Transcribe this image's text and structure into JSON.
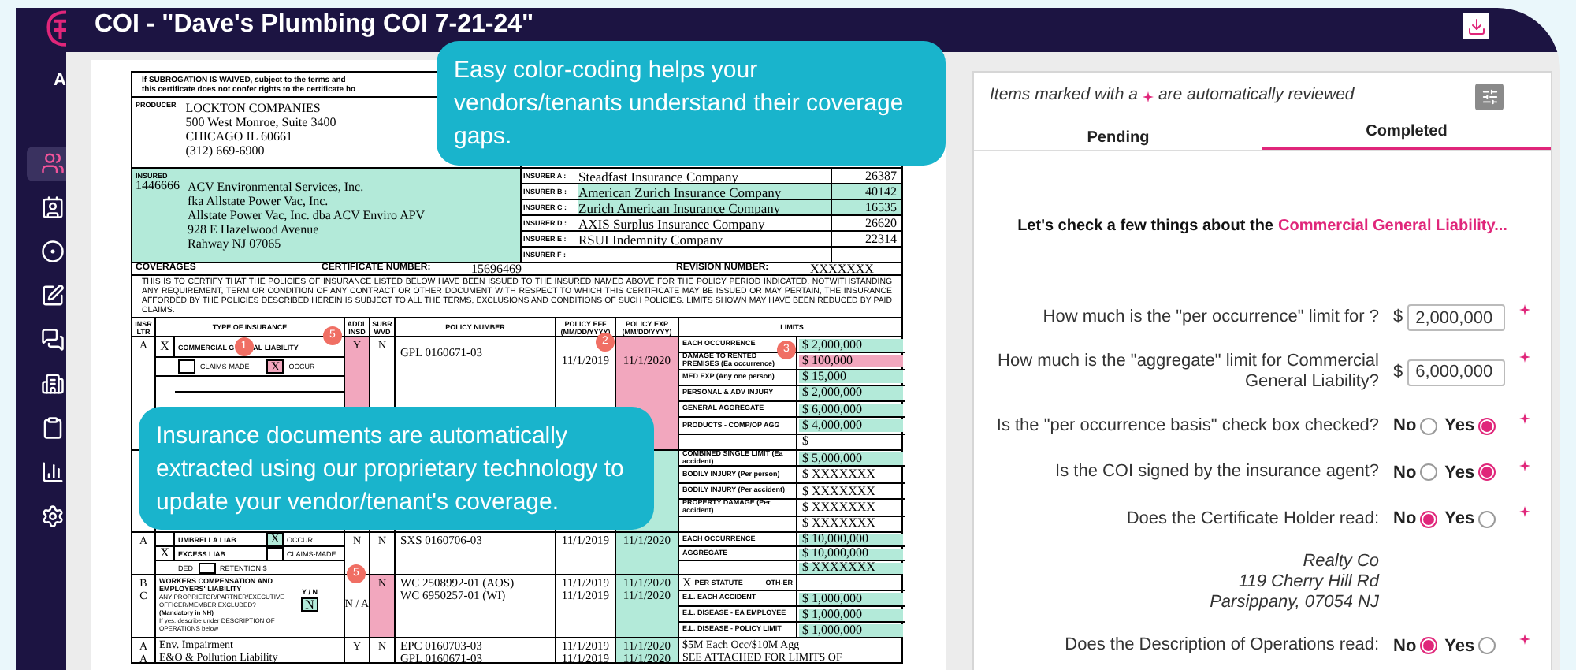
{
  "header": {
    "title": "COI - \"Dave's Plumbing COI 7-21-24\""
  },
  "sidebar": {
    "label": "A",
    "items": [
      {
        "selected": true
      },
      {
        "selected": false
      },
      {
        "selected": false
      },
      {
        "selected": false
      },
      {
        "selected": false
      },
      {
        "selected": false
      },
      {
        "selected": false
      },
      {
        "selected": false
      },
      {
        "selected": false
      }
    ]
  },
  "document": {
    "subrogation_lines": [
      "If SUBROGATION IS WAIVED, subject to the terms and",
      "this certificate does not confer rights to the certificate ho"
    ],
    "producer": {
      "label": "PRODUCER",
      "lines": [
        "LOCKTON COMPANIES",
        "500 West Monroe, Suite 3400",
        "CHICAGO IL 60661",
        "(312) 669-6900"
      ]
    },
    "insured": {
      "label": "INSURED",
      "number": "1446666",
      "color": "#b3ead9",
      "lines": [
        "ACV Environmental Services, Inc.",
        "fka Allstate Power Vac, Inc.",
        "Allstate Power Vac, Inc. dba ACV Enviro APV",
        "928 E Hazelwood Avenue",
        "Rahway NJ 07065"
      ]
    },
    "insurers": [
      {
        "label": "INSURER A :",
        "name": "Steadfast Insurance Company",
        "naic": "26387"
      },
      {
        "label": "INSURER B :",
        "name": "American Zurich Insurance Company",
        "naic": "40142",
        "color": "#b3ead9"
      },
      {
        "label": "INSURER C :",
        "name": "Zurich American Insurance Company",
        "naic": "16535",
        "color": "#b3ead9"
      },
      {
        "label": "INSURER D :",
        "name": "AXIS Surplus Insurance Company",
        "naic": "26620"
      },
      {
        "label": "INSURER E :",
        "name": "RSUI Indemnity Company",
        "naic": "22314"
      },
      {
        "label": "INSURER F :"
      }
    ],
    "coverages": {
      "title": "COVERAGES",
      "certificate_label": "CERTIFICATE NUMBER:",
      "certificate_number": "15696469",
      "revision_label": "REVISION NUMBER:",
      "revision_number": "XXXXXXX"
    },
    "notice": "THIS IS TO CERTIFY THAT THE POLICIES OF INSURANCE LISTED BELOW HAVE BEEN ISSUED TO THE INSURED NAMED ABOVE FOR THE POLICY PERIOD INDICATED. NOTWITHSTANDING ANY REQUIREMENT, TERM OR CONDITION OF ANY CONTRACT OR OTHER DOCUMENT WITH RESPECT TO WHICH THIS CERTIFICATE MAY BE ISSUED OR MAY PERTAIN, THE INSURANCE AFFORDED BY THE POLICIES DESCRIBED HEREIN IS SUBJECT TO ALL THE TERMS, EXCLUSIONS AND CONDITIONS OF SUCH POLICIES. LIMITS SHOWN MAY HAVE BEEN REDUCED BY PAID CLAIMS.",
    "columns": [
      "INSR LTR",
      "TYPE OF INSURANCE",
      "ADDL INSD",
      "SUBR WVD",
      "POLICY NUMBER",
      "POLICY EFF (MM/DD/YYYY)",
      "POLICY EXP (MM/DD/YYYY)",
      "LIMITS"
    ],
    "rows": [
      {
        "kind": "general_liability",
        "insr": [
          "A"
        ],
        "type_mark": "X",
        "type_parts": [
          "COMMERCIAL G",
          "AL LIABILITY"
        ],
        "type_badge": "1",
        "options": [
          {
            "label": "CLAIMS-MADE",
            "checked": false
          },
          {
            "label": "OCCUR",
            "checked": true,
            "mark": "X",
            "color": "#f2a7be"
          }
        ],
        "addl": {
          "text": "Y",
          "color": "#f2a7be"
        },
        "subr": {
          "text": "N"
        },
        "policies": [
          "GPL 0160671-03"
        ],
        "eff": [
          "11/1/2019"
        ],
        "exp": {
          "lines": [
            "11/1/2020"
          ],
          "color": "#f2a7be"
        },
        "limits": [
          {
            "label": "EACH OCCURRENCE",
            "value": "$ 2,000,000",
            "color": "#b3ead9"
          },
          {
            "label": "DAMAGE TO RENTED PREMISES (Ea occurrence)",
            "value": "$ 100,000",
            "color": "#f2a7be"
          },
          {
            "label": "MED EXP (Any one person)",
            "value": "$ 15,000",
            "color": "#b3ead9"
          },
          {
            "label": "PERSONAL & ADV INJURY",
            "value": "$ 2,000,000",
            "color": "#b3ead9"
          },
          {
            "label": "GENERAL AGGREGATE",
            "value": "$ 6,000,000",
            "color": "#b3ead9"
          },
          {
            "label": "PRODUCTS - COMP/OP AGG",
            "value": "$ 4,000,000",
            "color": "#b3ead9"
          },
          {
            "value": "$"
          }
        ]
      },
      {
        "kind": "auto",
        "exp": {
          "color": "#b3ead9"
        },
        "limits": [
          {
            "label": "COMBINED SINGLE LIMIT (Ea accident)",
            "value": "$ 5,000,000",
            "color": "#b3ead9"
          },
          {
            "label": "BODILY INJURY (Per person)",
            "value": "$ XXXXXXX"
          },
          {
            "label": "BODILY INJURY (Per accident)",
            "value": "$ XXXXXXX"
          },
          {
            "label": "PROPERTY DAMAGE (Per accident)",
            "value": "$ XXXXXXX"
          },
          {
            "value": "$ XXXXXXX"
          }
        ]
      },
      {
        "kind": "umbrella",
        "insr": [
          "A"
        ],
        "lines": [
          {
            "label": "UMBRELLA LIAB",
            "option": {
              "label": "OCCUR",
              "checked": true,
              "mark": "X",
              "color": "#b3ead9"
            }
          },
          {
            "mark": "X",
            "label": "EXCESS LIAB",
            "option": {
              "label": "CLAIMS-MADE",
              "checked": false
            }
          }
        ],
        "deductible": {
          "label": "DED",
          "retention": "RETENTION $"
        },
        "addl": {
          "text": "N"
        },
        "subr": {
          "text": "N"
        },
        "policies": [
          "SXS 0160706-03"
        ],
        "eff": [
          "11/1/2019"
        ],
        "exp": {
          "lines": [
            "11/1/2020"
          ],
          "color": "#b3ead9"
        },
        "limits": [
          {
            "label": "EACH OCCURRENCE",
            "value": "$ 10,000,000",
            "color": "#b3ead9"
          },
          {
            "label": "AGGREGATE",
            "value": "$ 10,000,000",
            "color": "#b3ead9"
          },
          {
            "value": "$ XXXXXXX",
            "color": "#b3ead9"
          }
        ]
      },
      {
        "kind": "workers_comp",
        "insr": [
          "B",
          "C"
        ],
        "title": "WORKERS COMPENSATION AND EMPLOYERS' LIABILITY",
        "question": "ANY PROPRIETOR/PARTNER/EXECUTIVE OFFICER/MEMBER EXCLUDED?",
        "mandatory": "(Mandatory in NH)",
        "note": "If yes, describe under DESCRIPTION OF OPERATIONS below",
        "yn_label": "Y / N",
        "answer": {
          "checked": true,
          "mark": "N",
          "color": "#b3ead9"
        },
        "addl": {
          "text": "N / A"
        },
        "subr": {
          "text": "N",
          "color": "#f2a7be"
        },
        "policies": [
          "WC 2508992-01 (AOS)",
          "WC 6950257-01 (WI)"
        ],
        "eff": [
          "11/1/2019",
          "11/1/2019"
        ],
        "exp": {
          "lines": [
            "11/1/2020",
            "11/1/2020"
          ],
          "color": "#b3ead9"
        },
        "statute": {
          "mark": "X",
          "per": "PER STATUTE",
          "other": "OTH-ER"
        },
        "limits": [
          {
            "label": "E.L. EACH ACCIDENT",
            "value": "$ 1,000,000",
            "color": "#b3ead9"
          },
          {
            "label": "E.L. DISEASE - EA EMPLOYEE",
            "value": "$ 1,000,000",
            "color": "#b3ead9"
          },
          {
            "label": "E.L. DISEASE - POLICY LIMIT",
            "value": "$ 1,000,000",
            "color": "#b3ead9"
          }
        ]
      },
      {
        "kind": "other",
        "insr": [
          "A",
          "A"
        ],
        "type_lines": [
          "Env. Impairment",
          "E&O & Pollution Liability"
        ],
        "addl": {
          "text": "Y"
        },
        "subr": {
          "text": "N"
        },
        "policies": [
          "EPC 0160703-03",
          "GPL 0160671-03"
        ],
        "eff": [
          "11/1/2019",
          "11/1/2019"
        ],
        "exp": {
          "lines": [
            "11/1/2020",
            "11/1/2020"
          ],
          "color": "#b3ead9"
        },
        "description": [
          "$5M Each Occ/$10M Agg",
          "SEE ATTACHED FOR LIMITS OF"
        ]
      }
    ]
  },
  "badges": [
    "5",
    "2",
    "3",
    "5"
  ],
  "tooltips": [
    {
      "text": "Easy color-coding helps your vendors/tenants understand their coverage gaps."
    },
    {
      "text": "Insurance documents are automatically extracted using our proprietary technology to update your vendor/tenant's coverage."
    }
  ],
  "review": {
    "note_before": "Items marked with a",
    "note_after": "are automatically reviewed",
    "tabs": [
      {
        "label": "Pending",
        "selected": false
      },
      {
        "label": "Completed",
        "selected": true
      }
    ],
    "intro": "Let's check a few things about the",
    "intro_highlight": "Commercial General Liability...",
    "questions": [
      {
        "kind": "amount",
        "text": "How much is the \"per occurrence\" limit for ?",
        "currency": "$",
        "value": "2,000,000",
        "auto_reviewed": true
      },
      {
        "kind": "amount",
        "text": "How much is the \"aggregate\" limit for Commercial General Liability?",
        "currency": "$",
        "value": "6,000,000",
        "auto_reviewed": true
      },
      {
        "kind": "choice",
        "text": "Is the \"per occurrence basis\" check box checked?",
        "options": [
          {
            "label": "No",
            "selected": false
          },
          {
            "label": "Yes",
            "selected": true
          }
        ],
        "auto_reviewed": true
      },
      {
        "kind": "choice",
        "text": "Is the COI signed by the insurance agent?",
        "options": [
          {
            "label": "No",
            "selected": false
          },
          {
            "label": "Yes",
            "selected": true
          }
        ],
        "auto_reviewed": true
      },
      {
        "kind": "choice",
        "text": "Does the Certificate Holder read:",
        "options": [
          {
            "label": "No",
            "selected": true
          },
          {
            "label": "Yes",
            "selected": false
          }
        ],
        "auto_reviewed": true,
        "detail_lines": [
          "Realty Co",
          "119 Cherry Hill Rd",
          "Parsippany, 07054 NJ"
        ]
      },
      {
        "kind": "choice",
        "text": "Does the Description of Operations read:",
        "options": [
          {
            "label": "No",
            "selected": true
          },
          {
            "label": "Yes",
            "selected": false
          }
        ],
        "auto_reviewed": true
      }
    ]
  }
}
